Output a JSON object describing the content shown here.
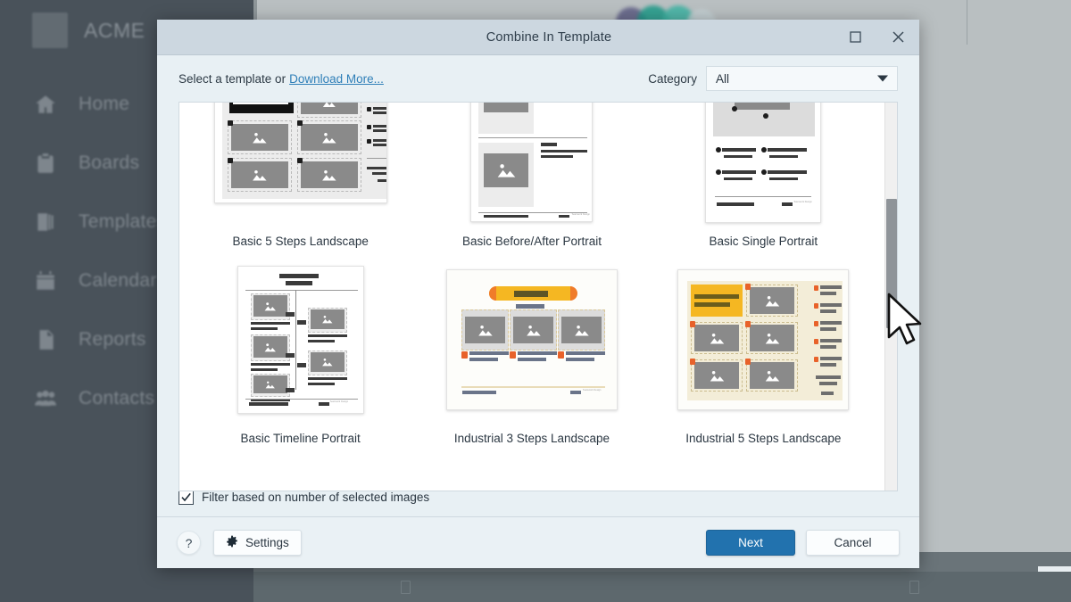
{
  "background": {
    "app_name": "ACME",
    "nav": [
      {
        "label": "Home",
        "icon": "home-icon"
      },
      {
        "label": "Boards",
        "icon": "clipboard-icon"
      },
      {
        "label": "Templates",
        "icon": "stack-icon"
      },
      {
        "label": "Calendar",
        "icon": "calendar-icon"
      },
      {
        "label": "Reports",
        "icon": "document-icon"
      },
      {
        "label": "Contacts",
        "icon": "people-icon"
      }
    ]
  },
  "dialog": {
    "title": "Combine In Template",
    "window_controls": [
      {
        "name": "maximize-button",
        "icon": "square-icon"
      },
      {
        "name": "close-button",
        "icon": "close-icon"
      }
    ],
    "header": {
      "select_label": "Select a template or",
      "download_more": "Download More...",
      "category_label": "Category",
      "category_value": "All",
      "category_options": [
        "All"
      ]
    },
    "templates": [
      {
        "name": "Basic 5 Steps Landscape",
        "style": "basic5",
        "orientation": "landscape"
      },
      {
        "name": "Basic Before/After Portrait",
        "style": "beforeafter",
        "orientation": "portrait"
      },
      {
        "name": "Basic Single Portrait",
        "style": "single",
        "orientation": "portrait"
      },
      {
        "name": "Basic Timeline Portrait",
        "style": "timeline",
        "orientation": "portrait"
      },
      {
        "name": "Industrial 3 Steps Landscape",
        "style": "ind3",
        "orientation": "landscape"
      },
      {
        "name": "Industrial 5 Steps Landscape",
        "style": "ind5",
        "orientation": "landscape"
      }
    ],
    "filter": {
      "label": "Filter based on number of selected images",
      "checked": true
    },
    "footer": {
      "help_label": "?",
      "settings_label": "Settings",
      "next_label": "Next",
      "cancel_label": "Cancel"
    },
    "scrollbar": {
      "orientation": "vertical"
    }
  },
  "colors": {
    "accent": "#2272ae",
    "link": "#2f7fb8",
    "dialog_bg": "#e8f0f4",
    "titlebar": "#ccd7e0",
    "sidebar": "#49525a",
    "industrial_accent": "#f5b722"
  }
}
